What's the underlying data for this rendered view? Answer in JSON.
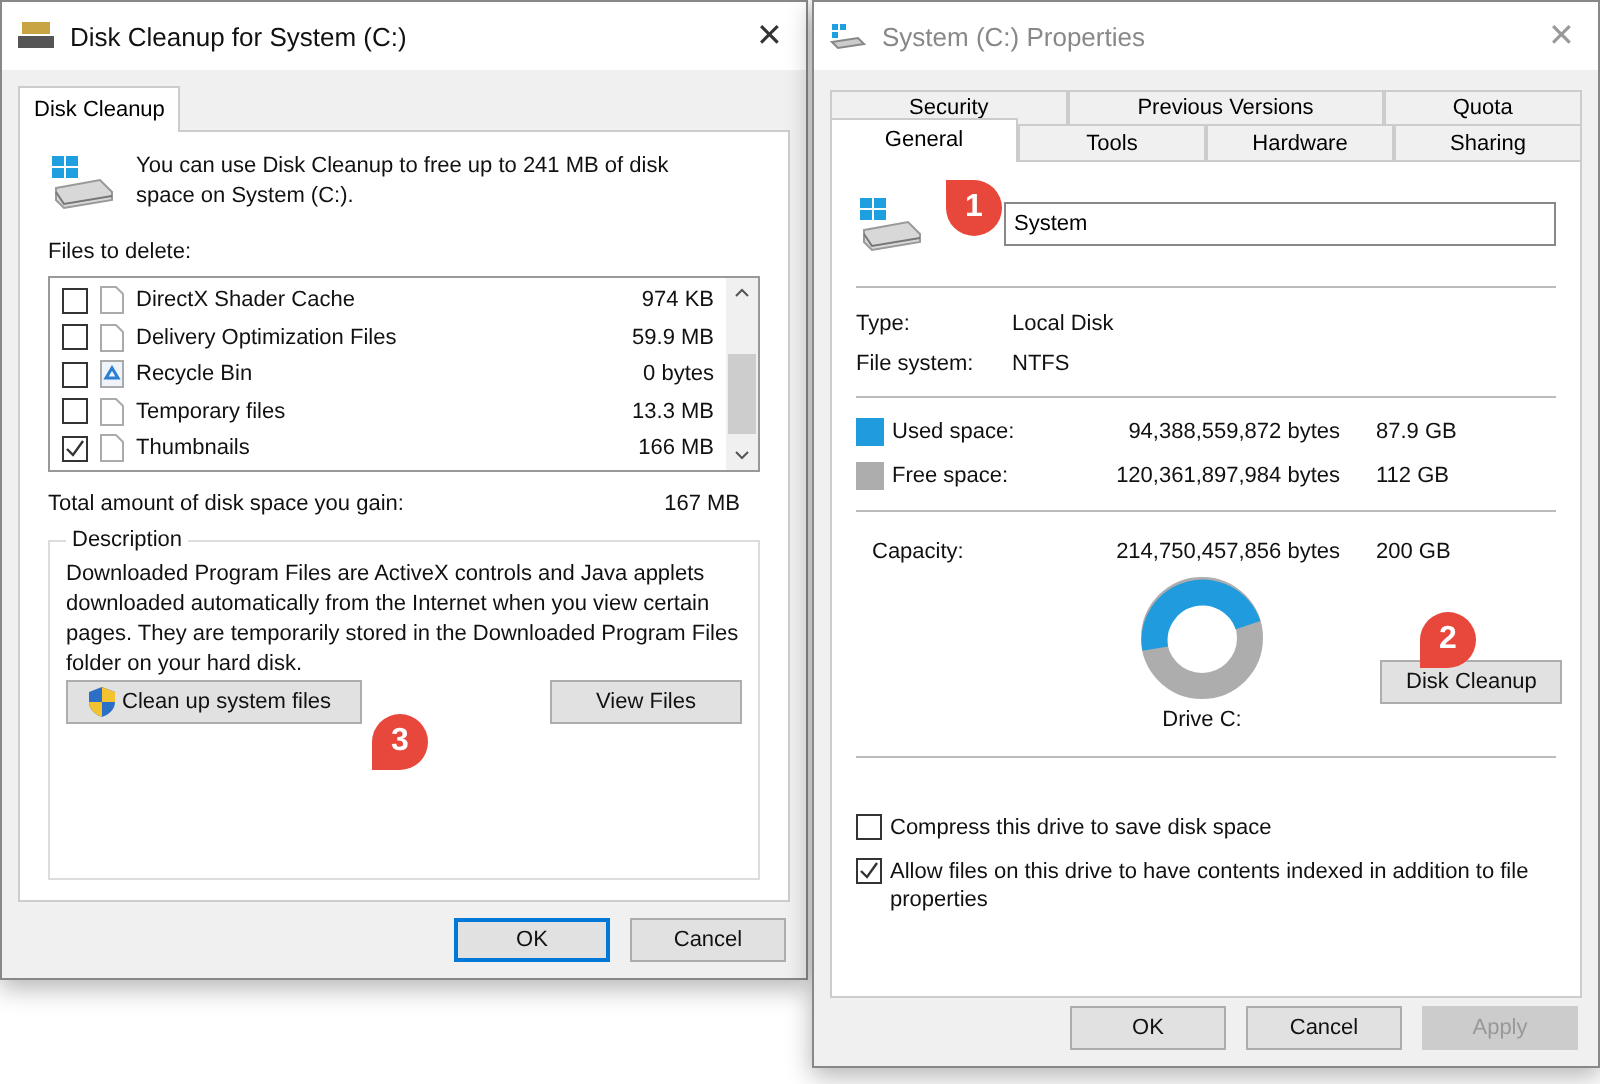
{
  "cleanup_window": {
    "title": "Disk Cleanup for System (C:)",
    "close": "✕",
    "tabs": [
      {
        "label": "Disk Cleanup",
        "selected": true
      }
    ],
    "intro": "You can use Disk Cleanup to free up to 241 MB of disk space on System (C:).",
    "files_label": "Files to delete:",
    "files": [
      {
        "kind": "file",
        "name": "DirectX Shader Cache",
        "size": "974 KB",
        "checked": false
      },
      {
        "kind": "file",
        "name": "Delivery Optimization Files",
        "size": "59.9 MB",
        "checked": false
      },
      {
        "kind": "recycle",
        "name": "Recycle Bin",
        "size": "0 bytes",
        "checked": false
      },
      {
        "kind": "file",
        "name": "Temporary files",
        "size": "13.3 MB",
        "checked": false
      },
      {
        "kind": "file",
        "name": "Thumbnails",
        "size": "166 MB",
        "checked": true
      }
    ],
    "total_label": "Total amount of disk space you gain:",
    "total_value": "167 MB",
    "description_title": "Description",
    "description": "Downloaded Program Files are ActiveX controls and Java applets downloaded automatically from the Internet when you view certain pages. They are temporarily stored in the Downloaded Program Files folder on your hard disk.",
    "actions": [
      {
        "kind": "shield",
        "label": "Clean up system files"
      },
      {
        "kind": "plain",
        "label": "View Files"
      }
    ],
    "buttons": [
      {
        "label": "OK",
        "default": true
      },
      {
        "label": "Cancel",
        "default": false
      }
    ]
  },
  "properties_window": {
    "title": "System (C:) Properties",
    "close": "✕",
    "tabs_back": [
      {
        "label": "Security",
        "selected": false
      },
      {
        "label": "Previous Versions",
        "selected": false
      },
      {
        "label": "Quota",
        "selected": false
      }
    ],
    "tabs_front": [
      {
        "label": "General",
        "selected": true
      },
      {
        "label": "Tools",
        "selected": false
      },
      {
        "label": "Hardware",
        "selected": false
      },
      {
        "label": "Sharing",
        "selected": false
      }
    ],
    "name_value": "System",
    "info": [
      {
        "label": "Type:",
        "value": "Local Disk"
      },
      {
        "label": "File system:",
        "value": "NTFS"
      }
    ],
    "space": [
      {
        "label": "Used space:",
        "bytes": "94,388,559,872 bytes",
        "size": "87.9 GB",
        "color": "#1f9bde"
      },
      {
        "label": "Free space:",
        "bytes": "120,361,897,984 bytes",
        "size": "112 GB",
        "color": "#adadad"
      }
    ],
    "capacity": {
      "label": "Capacity:",
      "bytes": "214,750,457,856 bytes",
      "size": "200 GB"
    },
    "drive_label": "Drive C:",
    "cleanup_button": "Disk Cleanup",
    "options": [
      {
        "label": "Compress this drive to save disk space",
        "checked": false
      },
      {
        "label": "Allow files on this drive to have contents indexed in addition to file properties",
        "checked": true
      }
    ],
    "buttons": [
      {
        "label": "OK",
        "disabled": false
      },
      {
        "label": "Cancel",
        "disabled": false
      },
      {
        "label": "Apply",
        "disabled": true
      }
    ]
  },
  "callouts": [
    {
      "number": "1"
    },
    {
      "number": "2"
    },
    {
      "number": "3"
    }
  ]
}
